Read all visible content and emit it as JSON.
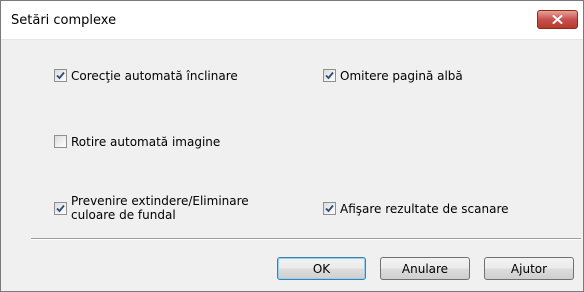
{
  "window": {
    "title": "Setări complexe"
  },
  "options": {
    "skew_correction": {
      "label": "Corecţie automată înclinare",
      "checked": true
    },
    "skip_blank": {
      "label": "Omitere pagină albă",
      "checked": true
    },
    "auto_rotate": {
      "label": "Rotire automată imagine",
      "checked": false
    },
    "bleed_through": {
      "label_line1": "Prevenire extindere/Eliminare",
      "label_line2": "culoare de fundal",
      "checked": true
    },
    "show_results": {
      "label": "Afişare rezultate de scanare",
      "checked": true
    }
  },
  "buttons": {
    "ok": "OK",
    "cancel": "Anulare",
    "help": "Ajutor"
  },
  "colors": {
    "close_button": "#c75050",
    "check": "#2a4d7b"
  }
}
